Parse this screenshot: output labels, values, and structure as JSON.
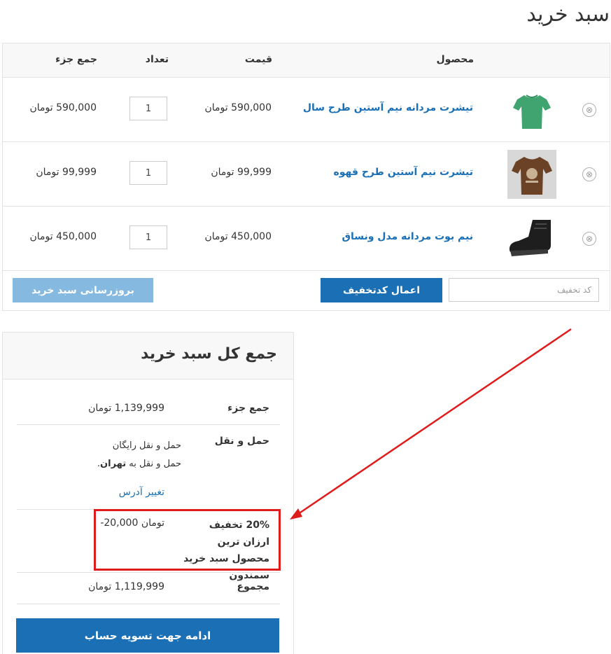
{
  "page_title": "سبد خرید",
  "cart": {
    "headers": {
      "product": "محصول",
      "price": "قیمت",
      "quantity": "تعداد",
      "subtotal": "جمع جزء"
    },
    "items": [
      {
        "name": "تیشرت مردانه نیم آستین طرح سال",
        "price": "590,000 تومان",
        "quantity": "1",
        "subtotal": "590,000 تومان",
        "thumbnail": "green-tshirt-image"
      },
      {
        "name": "تیشرت نیم آستین طرح قهوه",
        "price": "99,999 تومان",
        "quantity": "1",
        "subtotal": "99,999 تومان",
        "thumbnail": "brown-coffee-tshirt-image"
      },
      {
        "name": "نیم بوت مردانه مدل ونساق",
        "price": "450,000 تومان",
        "quantity": "1",
        "subtotal": "450,000 تومان",
        "thumbnail": "black-boot-image"
      }
    ],
    "remove_icon": "⊗",
    "coupon_placeholder": "کد تخفیف",
    "apply_coupon_label": "اعمال کدتخفیف",
    "update_cart_label": "بروزرسانی سبد خرید"
  },
  "totals": {
    "title": "جمع کل سبد خرید",
    "subtotal_label": "جمع جزء",
    "subtotal_value": "1,139,999 تومان",
    "shipping_label": "حمل و نقل",
    "shipping_method": "حمل و نقل رایگان",
    "shipping_to_prefix": "حمل و نقل به",
    "shipping_city": "تهران",
    "change_address_label": "تغییر آدرس",
    "discount_label": "20% تخفیف ارزان ترین محصول سبد خرید سمندون",
    "discount_value": "-20,000 تومان",
    "total_label": "مجموع",
    "total_value": "1,119,999 تومان",
    "checkout_label": "ادامه جهت تسویه حساب"
  },
  "colors": {
    "accent": "#1a6fb5",
    "button_disabled": "#86b9e0",
    "annotation": "#e01b1b",
    "header_bg": "#f8f8f8",
    "border": "#e3e3e3"
  }
}
